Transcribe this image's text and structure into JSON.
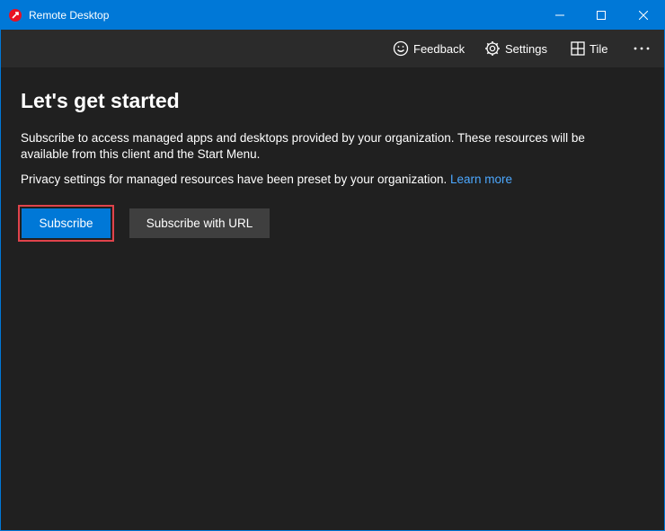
{
  "window": {
    "title": "Remote Desktop",
    "app_icon": "remote-desktop-icon",
    "controls": [
      "minimize-icon",
      "maximize-icon",
      "close-icon"
    ]
  },
  "commandbar": {
    "feedback_label": "Feedback",
    "settings_label": "Settings",
    "tile_label": "Tile",
    "more_icon": "more-icon"
  },
  "main": {
    "heading": "Let's get started",
    "description": "Subscribe to access managed apps and desktops provided by your organization. These resources will be available from this client and the Start Menu.",
    "privacy_text": "Privacy settings for managed resources have been preset by your organization. ",
    "learn_more": "Learn more",
    "subscribe_label": "Subscribe",
    "subscribe_url_label": "Subscribe with URL"
  },
  "colors": {
    "titlebar": "#0078d7",
    "background": "#202020",
    "commandbar": "#2b2b2b",
    "primary_button": "#0078d7",
    "secondary_button": "#3f3f3f",
    "link": "#4ca8ff",
    "highlight": "#e0434b"
  }
}
